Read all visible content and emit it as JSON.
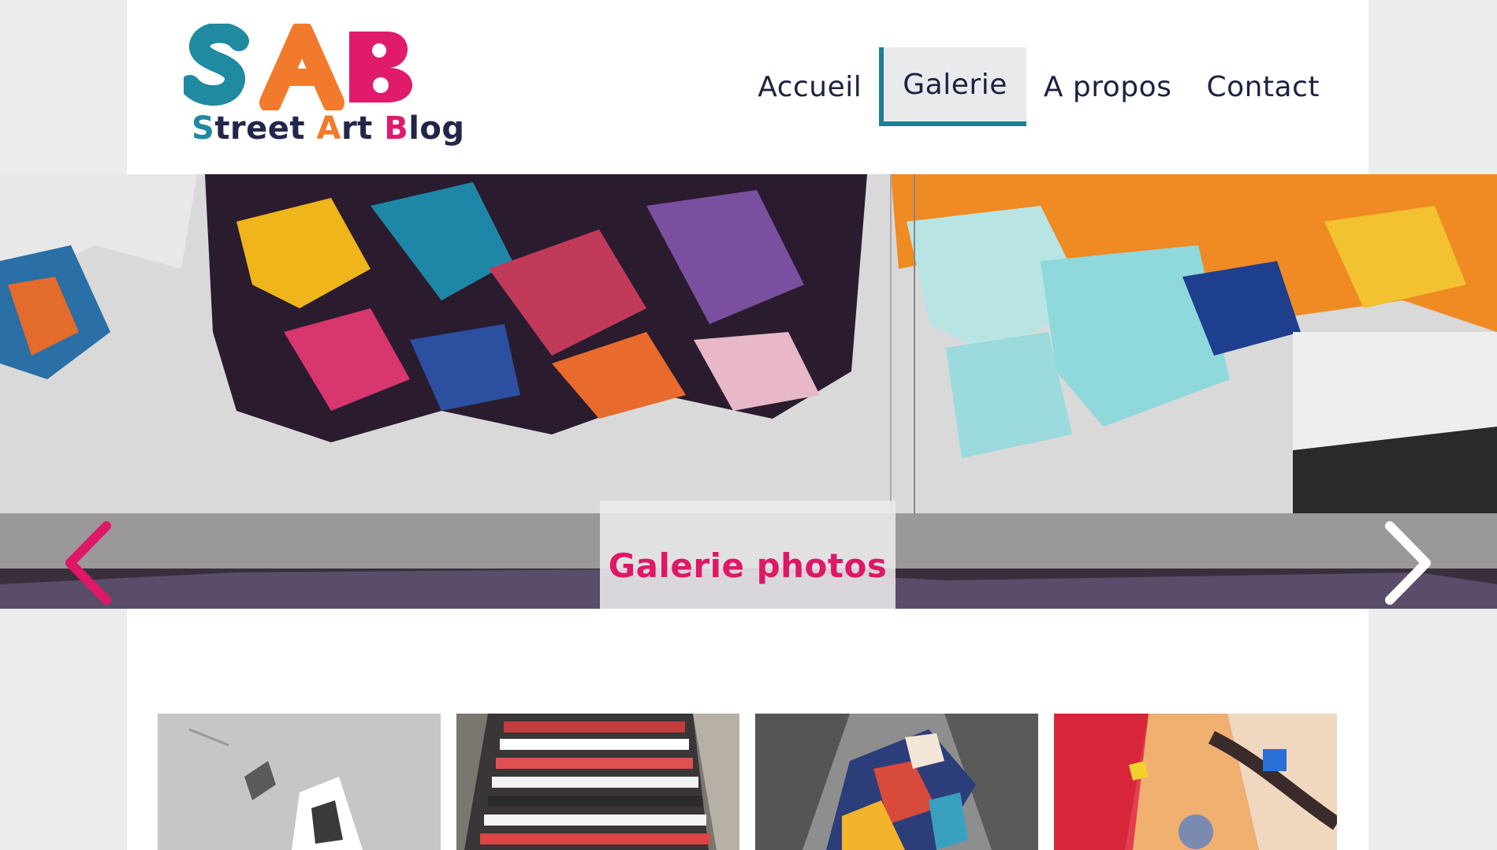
{
  "site": {
    "logo_letters": "SAB",
    "logo_tagline": {
      "part1_initial": "S",
      "part1_rest": "treet ",
      "part2_initial": "A",
      "part2_rest": "rt ",
      "part3_initial": "B",
      "part3_rest": "log"
    }
  },
  "nav": {
    "items": [
      {
        "label": "Accueil",
        "active": false
      },
      {
        "label": "Galerie",
        "active": true
      },
      {
        "label": "A propos",
        "active": false
      },
      {
        "label": "Contact",
        "active": false
      }
    ]
  },
  "hero": {
    "title": "Galerie photos",
    "prev_icon": "chevron-left-icon",
    "next_icon": "chevron-right-icon"
  },
  "colors": {
    "teal": "#1f8aa0",
    "orange": "#f27a2c",
    "pink": "#e01b6b",
    "navy": "#1d2240",
    "background": "#ececec"
  }
}
